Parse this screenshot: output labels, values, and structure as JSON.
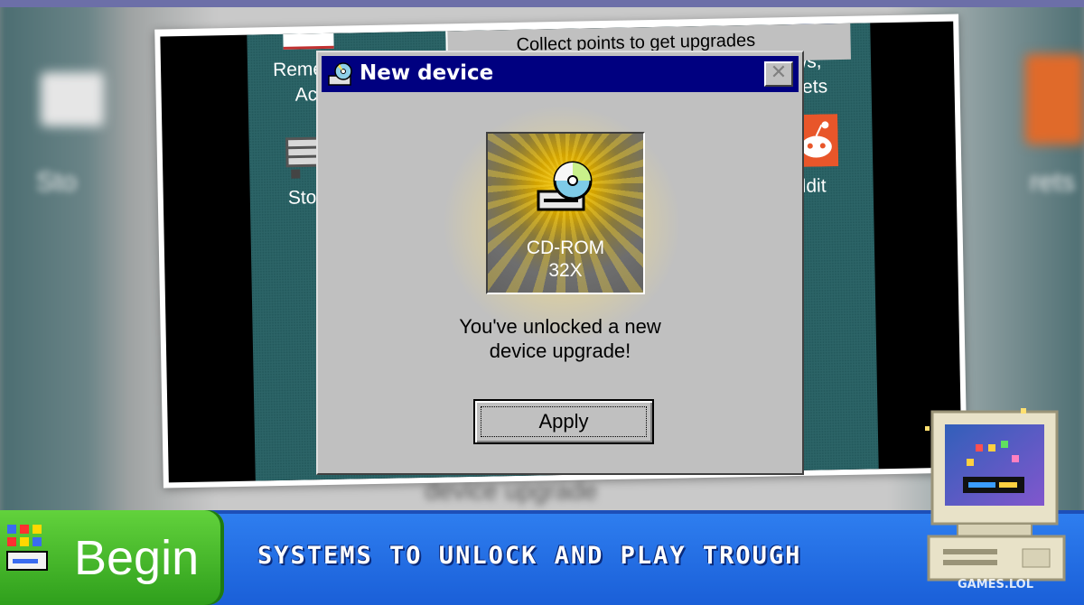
{
  "background_window": {
    "text": "Collect points to get upgrades"
  },
  "desktop_icons": [
    {
      "label": "Reme"
    },
    {
      "label": "Ac"
    },
    {
      "label": "Sto"
    },
    {
      "label": "ws,"
    },
    {
      "label": "crets"
    },
    {
      "label": "ddit"
    }
  ],
  "blurred_text": {
    "left": "Sto",
    "right": "rets",
    "bottom": "device upgrade"
  },
  "dialog": {
    "title": "New device",
    "close_label": "✕",
    "device_name_line1": "CD-ROM",
    "device_name_line2": "32X",
    "message_line1": "You've unlocked a new",
    "message_line2": "device upgrade!",
    "apply_label": "Apply"
  },
  "banner": {
    "begin_label": "Begin",
    "tagline": "SYSTEMS TO UNLOCK AND PLAY TROUGH"
  },
  "watermark": "GAMES.LOL",
  "colors": {
    "titlebar": "#000080",
    "desktop": "#2c6467",
    "banner_blue": "#2f7ff0",
    "begin_green": "#4cc22c"
  }
}
